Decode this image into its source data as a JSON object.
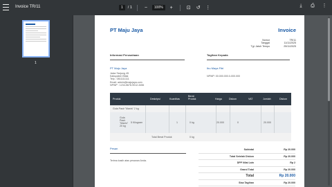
{
  "toolbar": {
    "title": "Invoice TR/11",
    "page_current": "1",
    "page_total": "/ 1",
    "zoom": "100%"
  },
  "sidebar": {
    "thumb_page": "1"
  },
  "invoice": {
    "company": "PT Maju Jaya",
    "doc_title": "Invoice",
    "meta": [
      {
        "k": "Nomor",
        "v": "TR/11"
      },
      {
        "k": "Tanggal",
        "v": "11/11/2025"
      },
      {
        "k": "Tgl. Jatuh Tempo",
        "v": "25/11/2025"
      }
    ],
    "sec_company": "Informasi Perusahaan",
    "sec_customer": "Tagihan Kepada",
    "company_name": "PT Maju Jaya",
    "company_lines": [
      "Jalan Tanjung 45",
      "Kabupaten Bitak",
      "Telp.: 0811111111",
      "Email: admin@majujaya.com",
      "NPWP : 1234-5678-9012-3456"
    ],
    "customer_name": "Ibu Maya Fitri",
    "customer_npwp": "NPWP: 00.000.000.0-000.000",
    "columns": [
      "Produk",
      "Deskripsi",
      "Kuantitas",
      "Berat Produk",
      "Harga",
      "Diskon",
      "VAT",
      "Jumlah",
      "Diskon"
    ],
    "group_label": "Gula Pasir \"Manis\" 2 kg",
    "item": {
      "product": "Gula Pasir \"Manis\" 20 kg",
      "qty_unit": "5    Kilogram",
      "qty": "1",
      "weight": "0 kg",
      "price": "20.000",
      "discount": "0",
      "amount": "20.000"
    },
    "total_weight_label": "Total Berat Produk",
    "total_weight": "0 kg",
    "notes_h": "Pesan",
    "notes": "Terima kasih atas pesanan Anda.",
    "summary": [
      {
        "k": "Subtotal",
        "v": "Rp 20.000"
      },
      {
        "k": "Total Setelah Diskon",
        "v": "Rp 20.000"
      },
      {
        "k": "DPP Nilai Lain",
        "v": "Rp 2"
      },
      {
        "k": "Grand Total",
        "v": "Rp 20.000"
      },
      {
        "k": "Total",
        "v": "Rp 20.000",
        "big": true
      },
      {
        "k": "Sisa Tagihan",
        "v": "Rp 20.000"
      }
    ]
  }
}
